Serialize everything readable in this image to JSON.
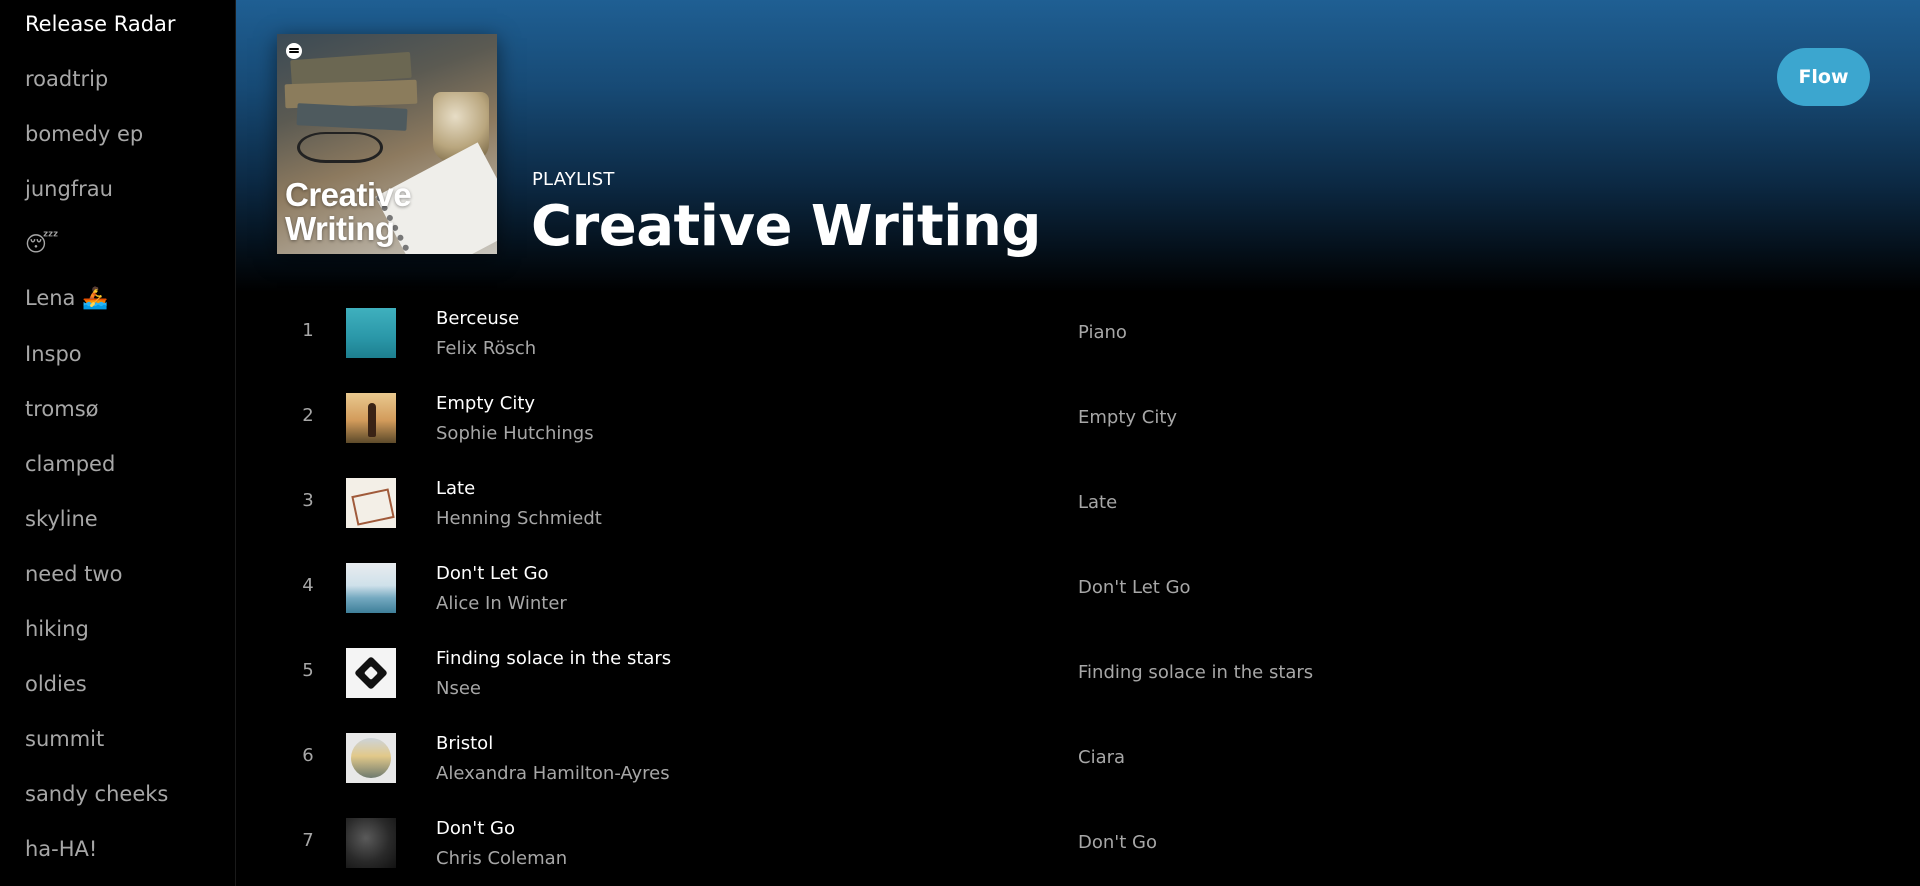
{
  "sidebar": {
    "items": [
      {
        "label": "Release Radar"
      },
      {
        "label": "roadtrip"
      },
      {
        "label": "bomedy ep"
      },
      {
        "label": "jungfrau"
      },
      {
        "label": "😴"
      },
      {
        "label": "Lena 🚣"
      },
      {
        "label": "Inspo"
      },
      {
        "label": "tromsø"
      },
      {
        "label": "clamped"
      },
      {
        "label": "skyline"
      },
      {
        "label": "need two"
      },
      {
        "label": "hiking"
      },
      {
        "label": "oldies"
      },
      {
        "label": "summit"
      },
      {
        "label": "sandy cheeks"
      },
      {
        "label": "ha-HA!"
      }
    ]
  },
  "header": {
    "cover_text_line1": "Creative",
    "cover_text_line2": "Writing",
    "type_label": "PLAYLIST",
    "title": "Creative Writing",
    "flow_button_label": "Flow",
    "gradient_color": "#1f5f93",
    "flow_button_color": "#3ca6cf"
  },
  "tracks": [
    {
      "num": "1",
      "title": "Berceuse",
      "artist": "Felix Rösch",
      "album": "Piano"
    },
    {
      "num": "2",
      "title": "Empty City",
      "artist": "Sophie Hutchings",
      "album": "Empty City"
    },
    {
      "num": "3",
      "title": "Late",
      "artist": "Henning Schmiedt",
      "album": "Late"
    },
    {
      "num": "4",
      "title": "Don't Let Go",
      "artist": "Alice In Winter",
      "album": "Don't Let Go"
    },
    {
      "num": "5",
      "title": "Finding solace in the stars",
      "artist": "Nsee",
      "album": "Finding solace in the stars"
    },
    {
      "num": "6",
      "title": "Bristol",
      "artist": "Alexandra Hamilton-Ayres",
      "album": "Ciara"
    },
    {
      "num": "7",
      "title": "Don't Go",
      "artist": "Chris Coleman",
      "album": "Don't Go"
    }
  ]
}
